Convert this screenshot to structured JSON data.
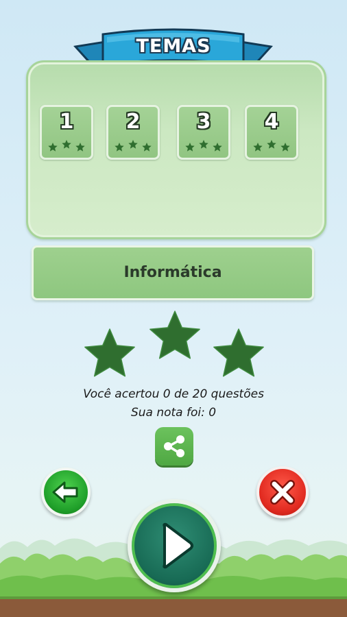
{
  "header": {
    "title": "TEMAS"
  },
  "levels": [
    {
      "number": "1",
      "stars_earned": 0,
      "stars_total": 3
    },
    {
      "number": "2",
      "stars_earned": 0,
      "stars_total": 3
    },
    {
      "number": "3",
      "stars_earned": 0,
      "stars_total": 3
    },
    {
      "number": "4",
      "stars_earned": 0,
      "stars_total": 3
    }
  ],
  "subject": {
    "label": "Informática"
  },
  "rating": {
    "stars_earned": 0,
    "stars_total": 3
  },
  "result": {
    "score_line": "Você acertou 0 de 20 questões",
    "grade_line": "Sua nota foi: 0"
  },
  "actions": {
    "share_icon": "share-icon",
    "back_icon": "arrow-left-icon",
    "close_icon": "close-icon",
    "play_icon": "play-icon"
  },
  "colors": {
    "panel_green": "#cce8c2",
    "star_green": "#2f6e2f",
    "back_green": "#20a02a",
    "close_red": "#e12a20",
    "play_teal": "#186b55",
    "ribbon_blue": "#2aa7d9"
  }
}
